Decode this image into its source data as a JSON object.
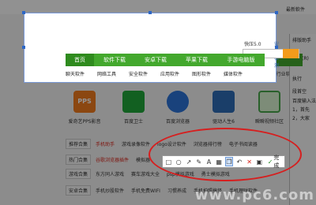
{
  "page": {
    "latest_download": "最新軟件",
    "kuaiya": "快压5.0",
    "anquan": "安全检测"
  },
  "nav": {
    "items": [
      "首页",
      "软件下载",
      "安卓下载",
      "苹果下载",
      "手游电脑版"
    ]
  },
  "subnav": {
    "items": [
      "聊天软件",
      "网络工具",
      "安全软件",
      "应用软件",
      "图形软件",
      "媒体软件",
      "行业软件"
    ]
  },
  "apps": [
    {
      "label": "爱奇艺PPS影音",
      "color": "#f07a1e",
      "icon": "pps-icon"
    },
    {
      "label": "百度卫士",
      "color": "#20a63a",
      "icon": "baidu-guard-icon"
    },
    {
      "label": "百度浏览器",
      "color": "#2b73d6",
      "icon": "baidu-browser-icon"
    },
    {
      "label": "驱动人生6",
      "color": "#2e6bb5",
      "icon": "driver-icon"
    },
    {
      "label": "瞬瞬视频社区",
      "color": "#48a54a",
      "icon": "frog-icon"
    }
  ],
  "tagrows": [
    {
      "tag": "推荐合集",
      "links": [
        "手机助手",
        "游戏录像软件",
        "logo设计软件",
        "浏览器排行榜",
        "电子书阅读器"
      ]
    },
    {
      "tag": "热门合集",
      "links": [
        "谷歌浏览器插件",
        "模拟器",
        "",
        "",
        ""
      ]
    },
    {
      "tag": "游戏合集",
      "links": [
        "东方同人游戏",
        "赛车游戏大全",
        "psp模拟游戏",
        "勇士模拟游戏"
      ]
    },
    {
      "tag": "安卓合集",
      "links": [
        "手机炒股软件",
        "手机免费WIFI",
        "习惯养成",
        "手机拍照搞怪",
        "手机理财软件"
      ]
    }
  ],
  "rightwin": {
    "title": "排版助手",
    "lines": [
      "排版(R)",
      "执行",
      "段首空",
      "百度输入法",
      "1，首先",
      "2，大家"
    ]
  },
  "toolbar": {
    "tools": [
      "rectangle-icon",
      "ellipse-icon",
      "arrow-icon",
      "brush-icon",
      "text-icon",
      "mosaic-icon",
      "copy-icon",
      "undo-icon",
      "close-icon",
      "save-icon"
    ],
    "done_label": "完成"
  },
  "watermark": "www.pc6.com"
}
